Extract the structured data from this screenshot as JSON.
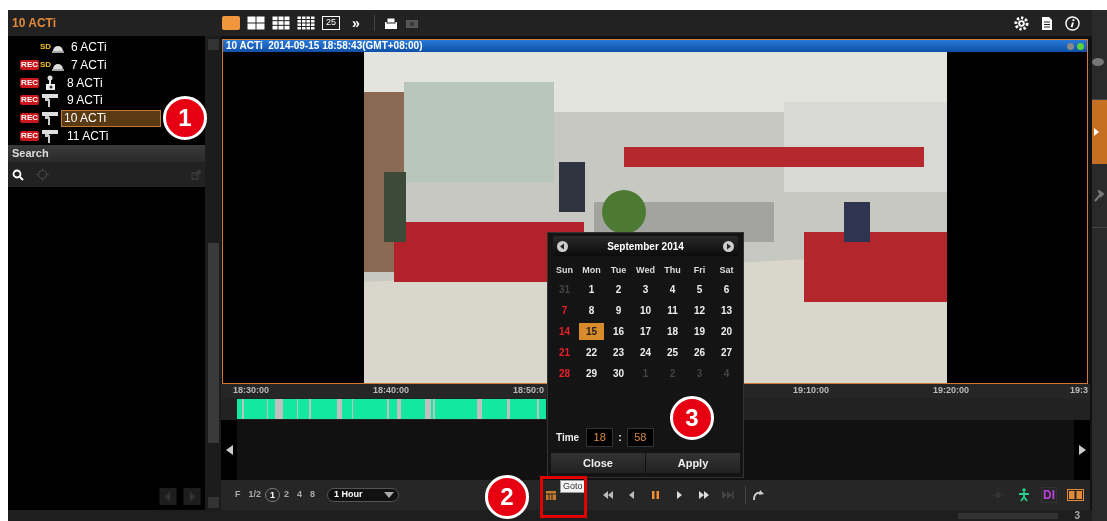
{
  "window": {
    "title": "10 ACTi"
  },
  "layouts": [
    {
      "kind": "single",
      "selected": true
    },
    {
      "kind": "quad",
      "selected": false
    },
    {
      "kind": "grid9",
      "selected": false
    },
    {
      "kind": "grid16",
      "selected": false
    },
    {
      "kind": "grid25",
      "label": "25",
      "selected": false
    },
    {
      "kind": "more",
      "label": "»",
      "selected": false
    }
  ],
  "cameras": [
    {
      "label": "6 ACTi",
      "kind": "sd",
      "sd_label": "SD",
      "selected": false
    },
    {
      "label": "7 ACTi",
      "kind": "sd",
      "sd_label": "SD",
      "rec": "REC",
      "selected": false
    },
    {
      "label": "8 ACTi",
      "kind": "box",
      "rec": "REC",
      "selected": false
    },
    {
      "label": "9 ACTi",
      "kind": "bullet",
      "rec": "REC",
      "selected": false
    },
    {
      "label": "10 ACTi",
      "kind": "bullet",
      "rec": "REC",
      "selected": true
    },
    {
      "label": "11 ACTi",
      "kind": "bullet",
      "rec": "REC",
      "selected": false
    }
  ],
  "search": {
    "title": "Search"
  },
  "video": {
    "caption": "10 ACTi  2014-09-15 18:58:43(GMT+08:00)",
    "kind": "picture"
  },
  "timeline": {
    "ticks": [
      "18:30:00",
      "18:40:00",
      "18:50:0",
      "19:10:00",
      "19:20:00",
      "19:3"
    ]
  },
  "speeds": [
    {
      "label": "F",
      "selected": false
    },
    {
      "label": "1/2",
      "selected": false
    },
    {
      "label": "1",
      "selected": true
    },
    {
      "label": "2",
      "selected": false
    },
    {
      "label": "4",
      "selected": false
    },
    {
      "label": "8",
      "selected": false
    }
  ],
  "range": {
    "value": "1 Hour"
  },
  "controls": {
    "di_label": "DI"
  },
  "calendar": {
    "month": "September 2014",
    "weekdays": [
      "Sun",
      "Mon",
      "Tue",
      "Wed",
      "Thu",
      "Fri",
      "Sat"
    ],
    "weeks": [
      [
        {
          "day": "31",
          "kind": "other",
          "selected": false
        },
        {
          "day": "1",
          "kind": "day",
          "selected": false
        },
        {
          "day": "2",
          "kind": "day",
          "selected": false
        },
        {
          "day": "3",
          "kind": "day",
          "selected": false
        },
        {
          "day": "4",
          "kind": "day",
          "selected": false
        },
        {
          "day": "5",
          "kind": "day",
          "selected": false
        },
        {
          "day": "6",
          "kind": "day",
          "selected": false
        }
      ],
      [
        {
          "day": "7",
          "kind": "sunday",
          "selected": false
        },
        {
          "day": "8",
          "kind": "day",
          "selected": false
        },
        {
          "day": "9",
          "kind": "day",
          "selected": false
        },
        {
          "day": "10",
          "kind": "day",
          "selected": false
        },
        {
          "day": "11",
          "kind": "day",
          "selected": false
        },
        {
          "day": "12",
          "kind": "day",
          "selected": false
        },
        {
          "day": "13",
          "kind": "day",
          "selected": false
        }
      ],
      [
        {
          "day": "14",
          "kind": "sunday",
          "selected": false
        },
        {
          "day": "15",
          "kind": "day",
          "selected": true
        },
        {
          "day": "16",
          "kind": "day",
          "selected": false
        },
        {
          "day": "17",
          "kind": "day",
          "selected": false
        },
        {
          "day": "18",
          "kind": "day",
          "selected": false
        },
        {
          "day": "19",
          "kind": "day",
          "selected": false
        },
        {
          "day": "20",
          "kind": "day",
          "selected": false
        }
      ],
      [
        {
          "day": "21",
          "kind": "sunday",
          "selected": false
        },
        {
          "day": "22",
          "kind": "day",
          "selected": false
        },
        {
          "day": "23",
          "kind": "day",
          "selected": false
        },
        {
          "day": "24",
          "kind": "day",
          "selected": false
        },
        {
          "day": "25",
          "kind": "day",
          "selected": false
        },
        {
          "day": "26",
          "kind": "day",
          "selected": false
        },
        {
          "day": "27",
          "kind": "day",
          "selected": false
        }
      ],
      [
        {
          "day": "28",
          "kind": "sunday",
          "selected": false
        },
        {
          "day": "29",
          "kind": "day",
          "selected": false
        },
        {
          "day": "30",
          "kind": "day",
          "selected": false
        },
        {
          "day": "1",
          "kind": "other",
          "selected": false
        },
        {
          "day": "2",
          "kind": "other",
          "selected": false
        },
        {
          "day": "3",
          "kind": "other",
          "selected": false
        },
        {
          "day": "4",
          "kind": "other",
          "selected": false
        }
      ]
    ],
    "time_label": "Time",
    "hour": "18",
    "separator": ":",
    "minute": "58",
    "buttons": [
      "Close",
      "Apply"
    ]
  },
  "tooltip": "Goto",
  "callouts": [
    "1",
    "2",
    "3"
  ],
  "status_bar": {
    "count": "3"
  }
}
